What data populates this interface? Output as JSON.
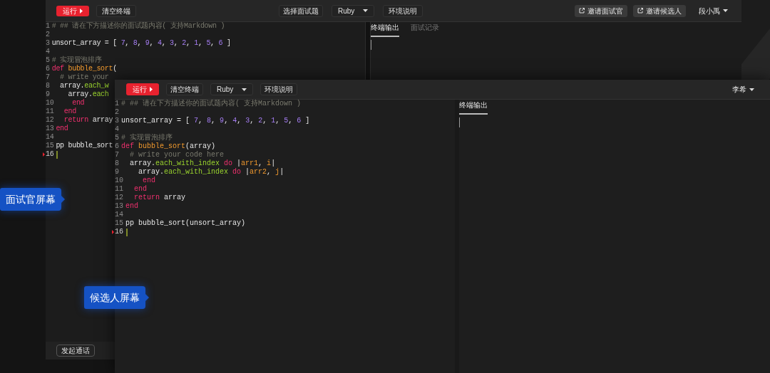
{
  "back_window": {
    "toolbar": {
      "run_button": "运行",
      "clear_button": "清空终端",
      "select_question_button": "选择面试题",
      "language_select": "Ruby",
      "environment_button": "环境说明",
      "invite_buttons": [
        "邀请面试官",
        "邀请候选人"
      ],
      "user_menu": "段小禹"
    },
    "editor": {
      "lines": [
        {
          "number": "1",
          "current": false,
          "tokens": [
            {
              "text": "# ## 请在下方描述你的面试题内容( 支持Markdown )",
              "kind": "comment"
            }
          ]
        },
        {
          "number": "2",
          "current": false
        },
        {
          "number": "3",
          "current": false,
          "tokens": [
            {
              "text": "unsort_array = [ ",
              "kind": "plain"
            },
            {
              "text": "7",
              "kind": "number"
            },
            {
              "text": ", ",
              "kind": "plain"
            },
            {
              "text": "8",
              "kind": "number"
            },
            {
              "text": ", ",
              "kind": "plain"
            },
            {
              "text": "9",
              "kind": "number"
            },
            {
              "text": ", ",
              "kind": "plain"
            },
            {
              "text": "4",
              "kind": "number"
            },
            {
              "text": ", ",
              "kind": "plain"
            },
            {
              "text": "3",
              "kind": "number"
            },
            {
              "text": ", ",
              "kind": "plain"
            },
            {
              "text": "2",
              "kind": "number"
            },
            {
              "text": ", ",
              "kind": "plain"
            },
            {
              "text": "1",
              "kind": "number"
            },
            {
              "text": ", ",
              "kind": "plain"
            },
            {
              "text": "5",
              "kind": "number"
            },
            {
              "text": ", ",
              "kind": "plain"
            },
            {
              "text": "6",
              "kind": "number"
            },
            {
              "text": " ]",
              "kind": "plain"
            }
          ]
        },
        {
          "number": "4",
          "current": false
        },
        {
          "number": "5",
          "current": false,
          "tokens": [
            {
              "text": "# 实现冒泡排序",
              "kind": "comment"
            }
          ]
        },
        {
          "number": "6",
          "current": false,
          "tokens": [
            {
              "text": "def ",
              "kind": "keyword"
            },
            {
              "text": "bubble_sort",
              "kind": "function"
            },
            {
              "text": "(",
              "kind": "plain"
            }
          ]
        },
        {
          "number": "7",
          "current": false,
          "tokens": [
            {
              "text": "  # write your",
              "kind": "comment"
            }
          ]
        },
        {
          "number": "8",
          "current": false,
          "tokens": [
            {
              "text": "  array.",
              "kind": "plain"
            },
            {
              "text": "each_w",
              "kind": "method"
            }
          ]
        },
        {
          "number": "9",
          "current": false,
          "tokens": [
            {
              "text": "    array.",
              "kind": "plain"
            },
            {
              "text": "each",
              "kind": "method"
            }
          ]
        },
        {
          "number": "10",
          "current": false,
          "tokens": [
            {
              "text": "    end",
              "kind": "keyword"
            }
          ]
        },
        {
          "number": "11",
          "current": false,
          "tokens": [
            {
              "text": "  end",
              "kind": "keyword"
            }
          ]
        },
        {
          "number": "12",
          "current": false,
          "tokens": [
            {
              "text": "  return ",
              "kind": "keyword"
            },
            {
              "text": "array",
              "kind": "plain"
            }
          ]
        },
        {
          "number": "13",
          "current": false,
          "tokens": [
            {
              "text": "end",
              "kind": "keyword"
            }
          ]
        },
        {
          "number": "14",
          "current": false
        },
        {
          "number": "15",
          "current": false,
          "tokens": [
            {
              "text": "pp bubble_sort",
              "kind": "plain"
            }
          ]
        },
        {
          "number": "16",
          "current": true
        }
      ]
    },
    "output_panel": {
      "tabs": [
        {
          "label": "终端输出",
          "selected": true
        },
        {
          "label": "面试记录",
          "selected": false
        }
      ]
    },
    "footer": {
      "call_button": "发起通话"
    }
  },
  "front_window": {
    "toolbar": {
      "run_button": "运行",
      "clear_button": "清空终端",
      "language_select": "Ruby",
      "environment_button": "环境说明",
      "user_menu": "李希"
    },
    "editor": {
      "lines": [
        {
          "number": "1",
          "current": false,
          "tokens": [
            {
              "text": "# ## 请在下方描述你的面试题内容( 支持Markdown )",
              "kind": "comment"
            }
          ]
        },
        {
          "number": "2",
          "current": false
        },
        {
          "number": "3",
          "current": false,
          "tokens": [
            {
              "text": "unsort_array = [ ",
              "kind": "plain"
            },
            {
              "text": "7",
              "kind": "number"
            },
            {
              "text": ", ",
              "kind": "plain"
            },
            {
              "text": "8",
              "kind": "number"
            },
            {
              "text": ", ",
              "kind": "plain"
            },
            {
              "text": "9",
              "kind": "number"
            },
            {
              "text": ", ",
              "kind": "plain"
            },
            {
              "text": "4",
              "kind": "number"
            },
            {
              "text": ", ",
              "kind": "plain"
            },
            {
              "text": "3",
              "kind": "number"
            },
            {
              "text": ", ",
              "kind": "plain"
            },
            {
              "text": "2",
              "kind": "number"
            },
            {
              "text": ", ",
              "kind": "plain"
            },
            {
              "text": "1",
              "kind": "number"
            },
            {
              "text": ", ",
              "kind": "plain"
            },
            {
              "text": "5",
              "kind": "number"
            },
            {
              "text": ", ",
              "kind": "plain"
            },
            {
              "text": "6",
              "kind": "number"
            },
            {
              "text": " ]",
              "kind": "plain"
            }
          ]
        },
        {
          "number": "4",
          "current": false
        },
        {
          "number": "5",
          "current": false,
          "tokens": [
            {
              "text": "# 实现冒泡排序",
              "kind": "comment"
            }
          ]
        },
        {
          "number": "6",
          "current": false,
          "tokens": [
            {
              "text": "def ",
              "kind": "keyword"
            },
            {
              "text": "bubble_sort",
              "kind": "function"
            },
            {
              "text": "(array)",
              "kind": "plain"
            }
          ]
        },
        {
          "number": "7",
          "current": false,
          "tokens": [
            {
              "text": "  # write your code here",
              "kind": "comment"
            }
          ]
        },
        {
          "number": "8",
          "current": false,
          "tokens": [
            {
              "text": "  array.",
              "kind": "plain"
            },
            {
              "text": "each_with_index",
              "kind": "method"
            },
            {
              "text": " do ",
              "kind": "keyword"
            },
            {
              "text": "|",
              "kind": "plain"
            },
            {
              "text": "arr1",
              "kind": "param"
            },
            {
              "text": ", ",
              "kind": "plain"
            },
            {
              "text": "i",
              "kind": "param"
            },
            {
              "text": "|",
              "kind": "plain"
            }
          ]
        },
        {
          "number": "9",
          "current": false,
          "tokens": [
            {
              "text": "    array.",
              "kind": "plain"
            },
            {
              "text": "each_with_index",
              "kind": "method"
            },
            {
              "text": " do ",
              "kind": "keyword"
            },
            {
              "text": "|",
              "kind": "plain"
            },
            {
              "text": "arr2",
              "kind": "param"
            },
            {
              "text": ", ",
              "kind": "plain"
            },
            {
              "text": "j",
              "kind": "param"
            },
            {
              "text": "|",
              "kind": "plain"
            }
          ]
        },
        {
          "number": "10",
          "current": false,
          "tokens": [
            {
              "text": "    end",
              "kind": "keyword"
            }
          ]
        },
        {
          "number": "11",
          "current": false,
          "tokens": [
            {
              "text": "  end",
              "kind": "keyword"
            }
          ]
        },
        {
          "number": "12",
          "current": false,
          "tokens": [
            {
              "text": "  return ",
              "kind": "keyword"
            },
            {
              "text": "array",
              "kind": "plain"
            }
          ]
        },
        {
          "number": "13",
          "current": false,
          "tokens": [
            {
              "text": "end",
              "kind": "keyword"
            }
          ]
        },
        {
          "number": "14",
          "current": false
        },
        {
          "number": "15",
          "current": false,
          "tokens": [
            {
              "text": "pp bubble_sort(unsort_array)",
              "kind": "plain"
            }
          ]
        },
        {
          "number": "16",
          "current": true
        }
      ]
    },
    "output_panel": {
      "tabs": [
        {
          "label": "终端输出",
          "selected": true
        }
      ]
    }
  },
  "callouts": [
    {
      "label": "面试官屏幕"
    },
    {
      "label": "候选人屏幕"
    }
  ]
}
